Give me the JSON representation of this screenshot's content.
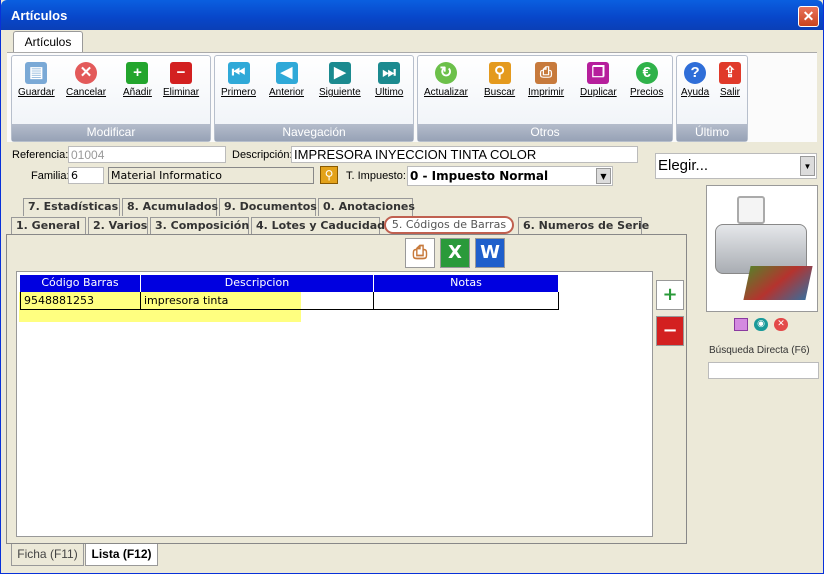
{
  "window": {
    "title": "Artículos",
    "close": "✕"
  },
  "ribbon": {
    "tab": "Artículos",
    "groups": [
      {
        "label": "Modificar"
      },
      {
        "label": "Navegación"
      },
      {
        "label": "Otros"
      },
      {
        "label": "Último"
      }
    ],
    "buttons": {
      "guardar": "Guardar",
      "cancelar": "Cancelar",
      "anadir": "Añadir",
      "eliminar": "Eliminar",
      "primero": "Primero",
      "anterior": "Anterior",
      "siguiente": "Siguiente",
      "ultimo": "Ultimo",
      "actualizar": "Actualizar",
      "buscar": "Buscar",
      "imprimir": "Imprimir",
      "duplicar": "Duplicar",
      "precios": "Precios",
      "ayuda": "Ayuda",
      "salir": "Salir"
    }
  },
  "form": {
    "referencia_label": "Referencia:",
    "referencia": "01004",
    "descripcion_label": "Descripción:",
    "descripcion": "IMPRESORA INYECCION TINTA COLOR",
    "familia_label": "Familia:",
    "familia_code": "6",
    "familia_name": "Material Informatico",
    "impuesto_label": "T. Impuesto:",
    "impuesto": "0 - Impuesto Normal",
    "elegir": "Elegir..."
  },
  "tabs_top": [
    "7. Estadísticas",
    "8. Acumulados",
    "9. Documentos",
    "0. Anotaciones"
  ],
  "tabs_bottom": [
    "1. General",
    "2. Varios",
    "3. Composición",
    "4. Lotes y Caducidad",
    "5. Códigos de Barras",
    "6. Numeros de Serie"
  ],
  "grid": {
    "headers": [
      "Código Barras",
      "Descripcion",
      "Notas"
    ],
    "rows": [
      [
        "9548881253",
        "impresora tinta",
        ""
      ]
    ]
  },
  "side": {
    "busqueda": "Búsqueda Directa (F6)"
  },
  "bottom_tabs": [
    "Ficha (F11)",
    "Lista (F12)"
  ],
  "colors": {
    "accent": "#0000e0",
    "highlight": "#ffff80"
  }
}
